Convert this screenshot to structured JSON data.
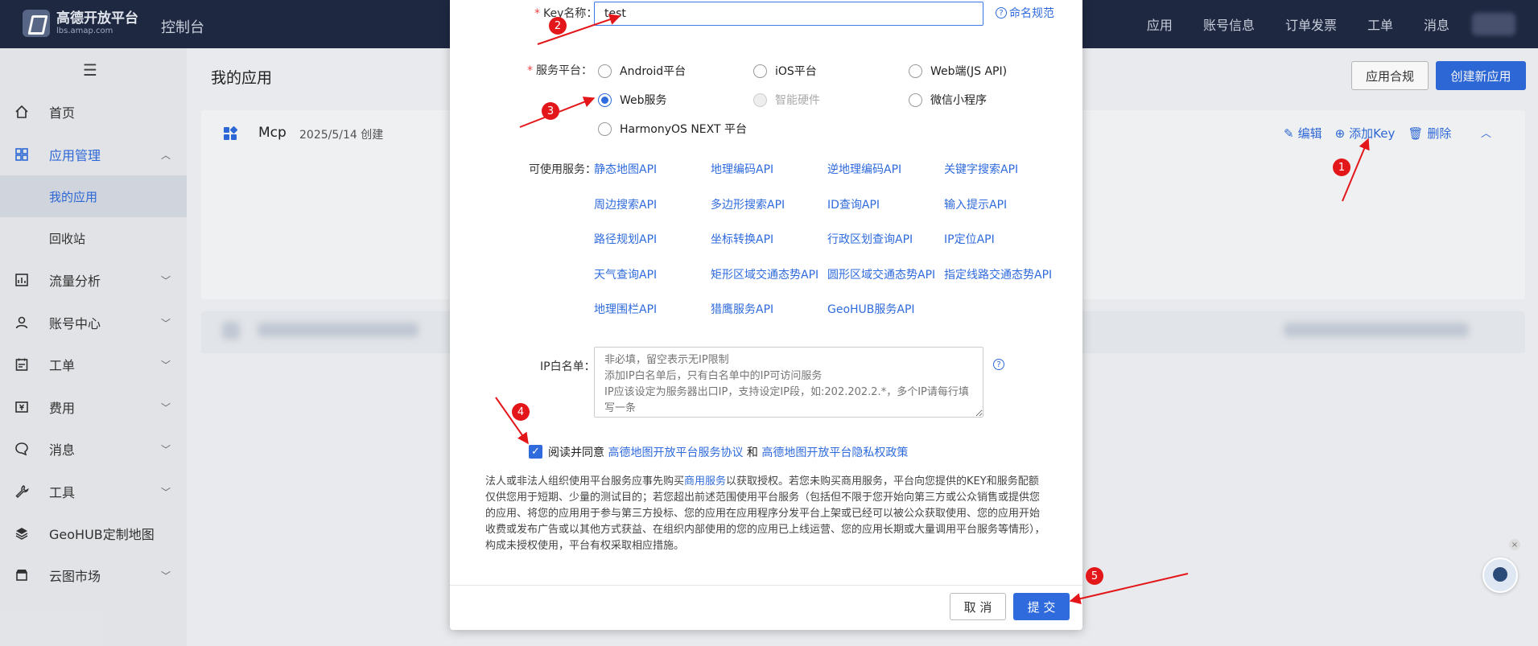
{
  "topbar": {
    "logo_title": "高德开放平台",
    "logo_sub": "lbs.amap.com",
    "console": "控制台",
    "nav": [
      "应用",
      "账号信息",
      "订单发票",
      "工单",
      "消息"
    ]
  },
  "sidebar": {
    "items": [
      {
        "label": "首页",
        "icon": "home-icon"
      },
      {
        "label": "应用管理",
        "icon": "grid-icon"
      },
      {
        "label": "我的应用"
      },
      {
        "label": "回收站"
      },
      {
        "label": "流量分析",
        "icon": "chart-icon"
      },
      {
        "label": "账号中心",
        "icon": "user-icon"
      },
      {
        "label": "工单",
        "icon": "ticket-icon"
      },
      {
        "label": "费用",
        "icon": "money-icon"
      },
      {
        "label": "消息",
        "icon": "message-icon"
      },
      {
        "label": "工具",
        "icon": "wrench-icon"
      },
      {
        "label": "GeoHUB定制地图",
        "icon": "layers-icon"
      },
      {
        "label": "云图市场",
        "icon": "store-icon"
      }
    ]
  },
  "main": {
    "title": "我的应用",
    "btn_compliance": "应用合规",
    "btn_create": "创建新应用",
    "app": {
      "name": "Mcp",
      "date": "2025/5/14 创建",
      "edit": "编辑",
      "add_key": "添加Key",
      "delete": "删除"
    }
  },
  "modal": {
    "key_label": "Key名称：",
    "key_value": "test",
    "naming_rule": "命名规范",
    "platform_label": "服务平台：",
    "platforms": {
      "android": "Android平台",
      "ios": "iOS平台",
      "web_js": "Web端(JS API)",
      "web_service": "Web服务",
      "smart_hw": "智能硬件",
      "wechat": "微信小程序",
      "harmony": "HarmonyOS NEXT 平台"
    },
    "services_label": "可使用服务：",
    "apis": [
      "静态地图API",
      "地理编码API",
      "逆地理编码API",
      "关键字搜索API",
      "周边搜索API",
      "多边形搜索API",
      "ID查询API",
      "输入提示API",
      "路径规划API",
      "坐标转换API",
      "行政区划查询API",
      "IP定位API",
      "天气查询API",
      "矩形区域交通态势API",
      "圆形区域交通态势API",
      "指定线路交通态势API",
      "地理围栏API",
      "猎鹰服务API",
      "GeoHUB服务API"
    ],
    "ip_label": "IP白名单：",
    "ip_placeholder": "非必填，留空表示无IP限制\n添加IP白名单后，只有白名单中的IP可访问服务\nIP应该设定为服务器出口IP，支持设定IP段，如:202.202.2.*，多个IP请每行填写一条",
    "agree_prefix": "阅读并同意 ",
    "agree_link1": "高德地图开放平台服务协议",
    "agree_and": " 和 ",
    "agree_link2": "高德地图开放平台隐私权政策",
    "disclaimer_1": "法人或非法人组织使用平台服务应事先购买",
    "disclaimer_link": "商用服务",
    "disclaimer_2": "以获取授权。若您未购买商用服务，平台向您提供的KEY和服务配额仅供您用于短期、少量的测试目的；若您超出前述范围使用平台服务（包括但不限于您开始向第三方或公众销售或提供您的应用、将您的应用用于参与第三方投标、您的应用在应用程序分发平台上架或已经可以被公众获取使用、您的应用开始收费或发布广告或以其他方式获益、在组织内部使用的您的应用已上线运营、您的应用长期或大量调用平台服务等情形），构成未授权使用，平台有权采取相应措施。",
    "cancel": "取 消",
    "submit": "提 交"
  },
  "annotations": {
    "badges": [
      "1",
      "2",
      "3",
      "4",
      "5"
    ],
    "color": "#e3161a"
  },
  "colors": {
    "accent": "#2f6bdc",
    "topbar": "#1f2a44"
  }
}
